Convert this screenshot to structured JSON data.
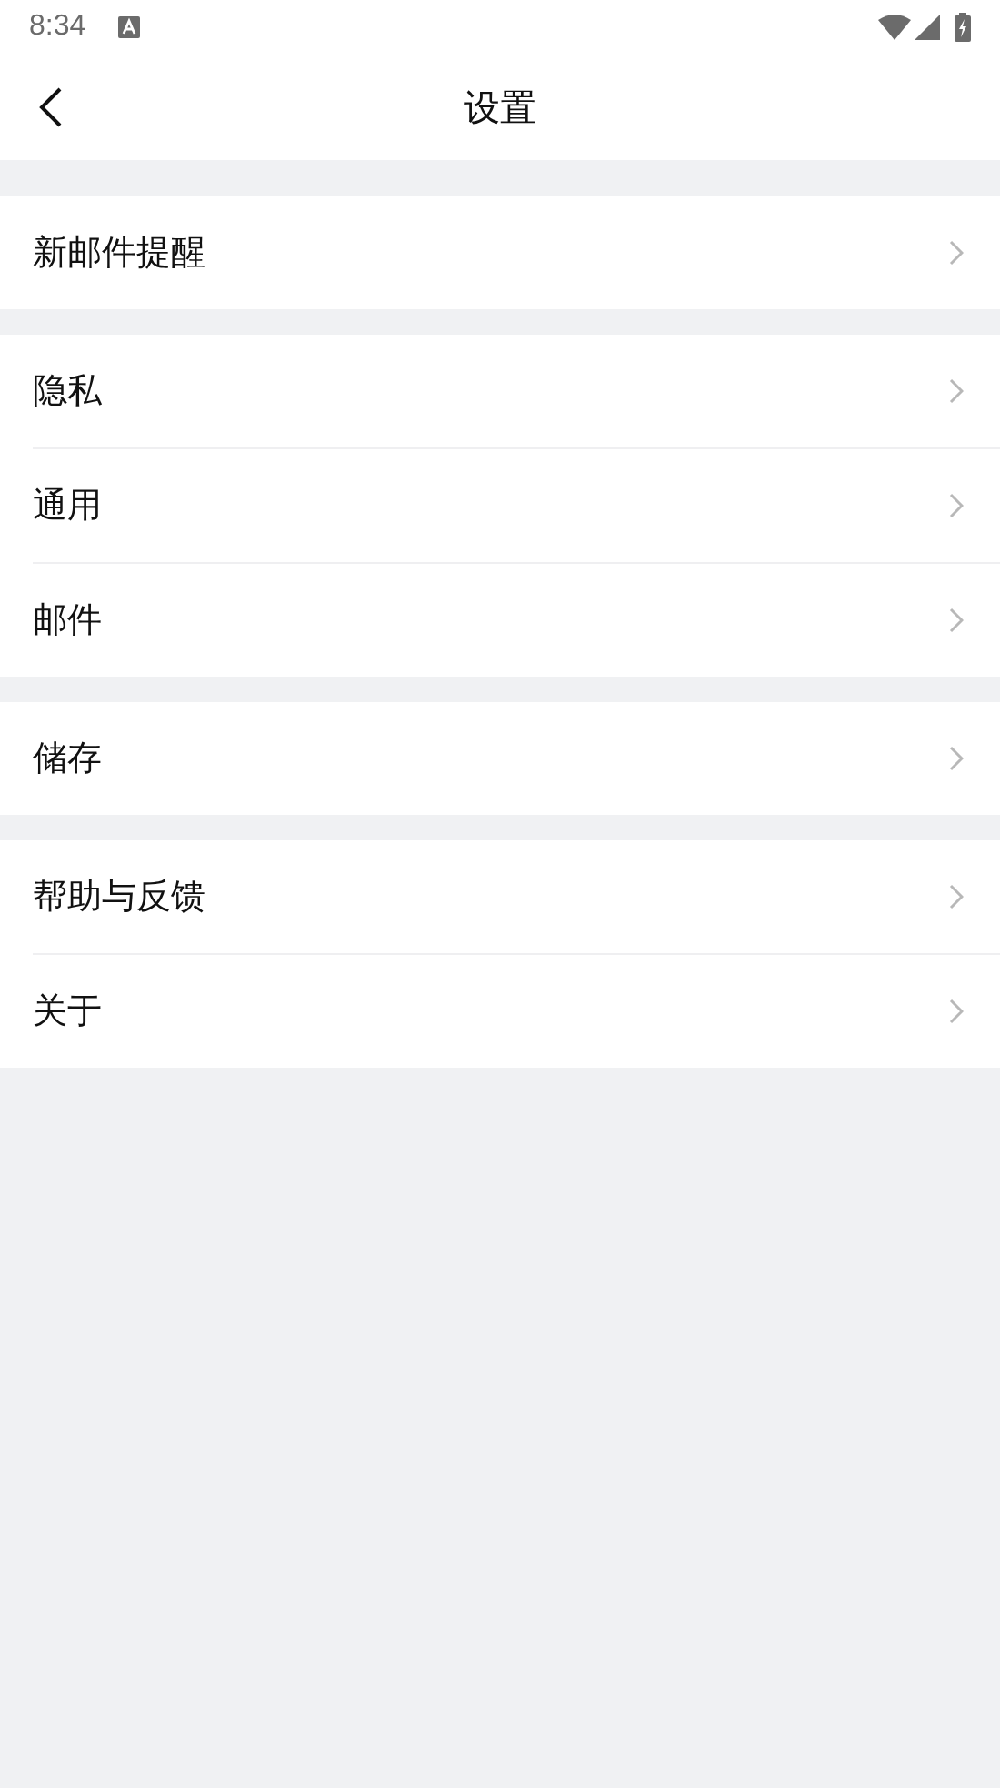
{
  "status_bar": {
    "time": "8:34"
  },
  "header": {
    "title": "设置"
  },
  "groups": [
    {
      "items": [
        {
          "label": "新邮件提醒"
        }
      ]
    },
    {
      "items": [
        {
          "label": "隐私"
        },
        {
          "label": "通用"
        },
        {
          "label": "邮件"
        }
      ]
    },
    {
      "items": [
        {
          "label": "储存"
        }
      ]
    },
    {
      "items": [
        {
          "label": "帮助与反馈"
        },
        {
          "label": "关于"
        }
      ]
    }
  ]
}
